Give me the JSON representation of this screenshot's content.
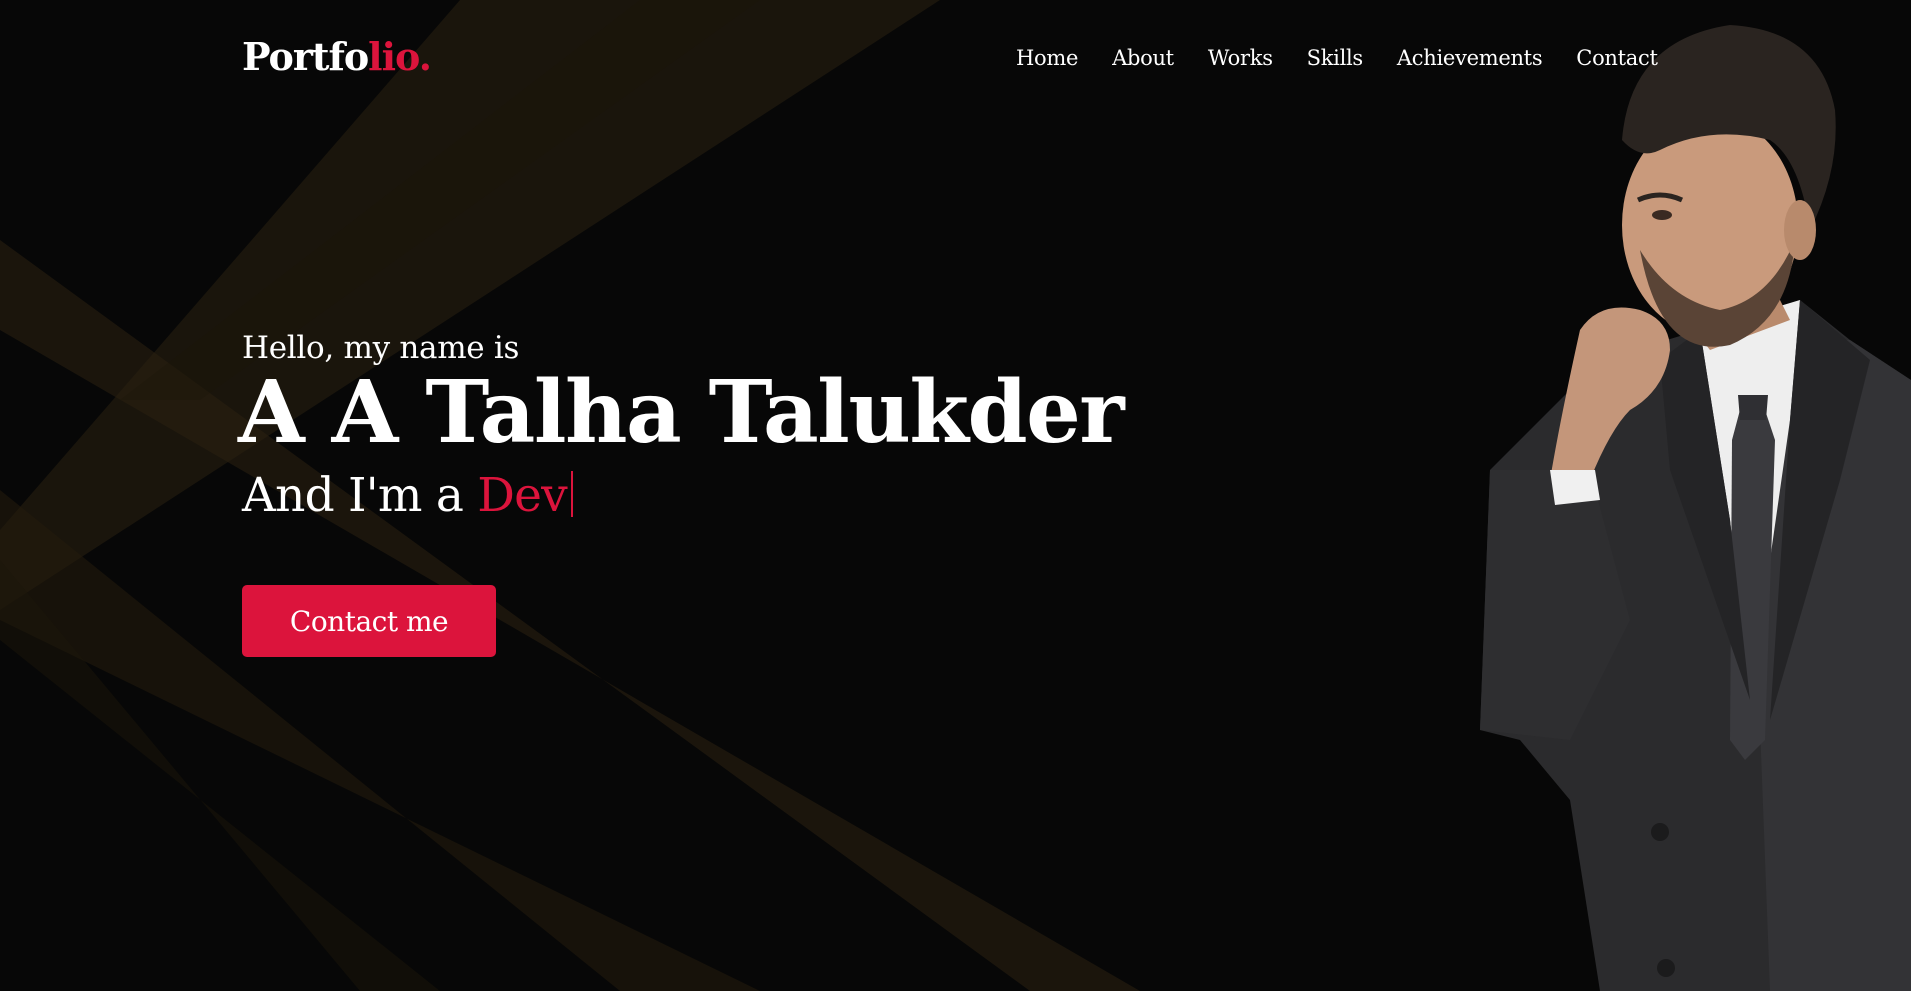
{
  "brand": {
    "logo_main": "Portfo",
    "logo_accent": "lio."
  },
  "nav": {
    "items": [
      {
        "label": "Home"
      },
      {
        "label": "About"
      },
      {
        "label": "Works"
      },
      {
        "label": "Skills"
      },
      {
        "label": "Achievements"
      },
      {
        "label": "Contact"
      }
    ]
  },
  "hero": {
    "greeting": "Hello, my name is",
    "name": "A A Talha Talukder",
    "role_prefix": "And I'm a ",
    "role_typed": "Dev",
    "cta_label": "Contact me",
    "portrait_icon": "person-photo-icon"
  },
  "colors": {
    "background": "#070707",
    "accent": "#dc143c",
    "text": "#ffffff",
    "ray": "#3a2c10"
  }
}
